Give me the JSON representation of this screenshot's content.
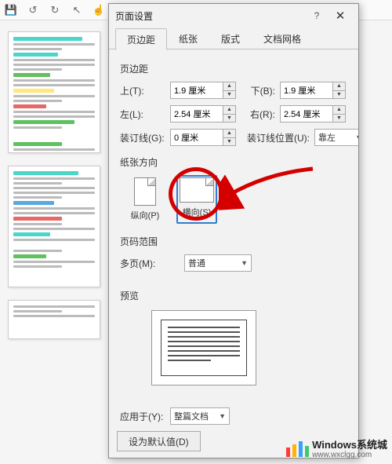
{
  "dialog": {
    "title": "页面设置",
    "help": "?",
    "close": "✕",
    "tabs": [
      "页边距",
      "纸张",
      "版式",
      "文档网格"
    ],
    "margins": {
      "section_label": "页边距",
      "top_label": "上(T):",
      "top_val": "1.9 厘米",
      "bottom_label": "下(B):",
      "bottom_val": "1.9 厘米",
      "left_label": "左(L):",
      "left_val": "2.54 厘米",
      "right_label": "右(R):",
      "right_val": "2.54 厘米",
      "gutter_label": "装订线(G):",
      "gutter_val": "0 厘米",
      "gutter_pos_label": "装订线位置(U):",
      "gutter_pos_val": "靠左"
    },
    "orientation": {
      "section_label": "纸张方向",
      "portrait_label": "纵向(P)",
      "landscape_label": "横向(S)"
    },
    "pagerange": {
      "section_label": "页码范围",
      "multi_label": "多页(M):",
      "multi_val": "普通"
    },
    "preview_label": "预览",
    "apply_label": "应用于(Y):",
    "apply_val": "整篇文档",
    "default_btn": "设为默认值(D)"
  },
  "watermark": {
    "name": "Windows系统城",
    "url": "www.wxclgg.com"
  }
}
